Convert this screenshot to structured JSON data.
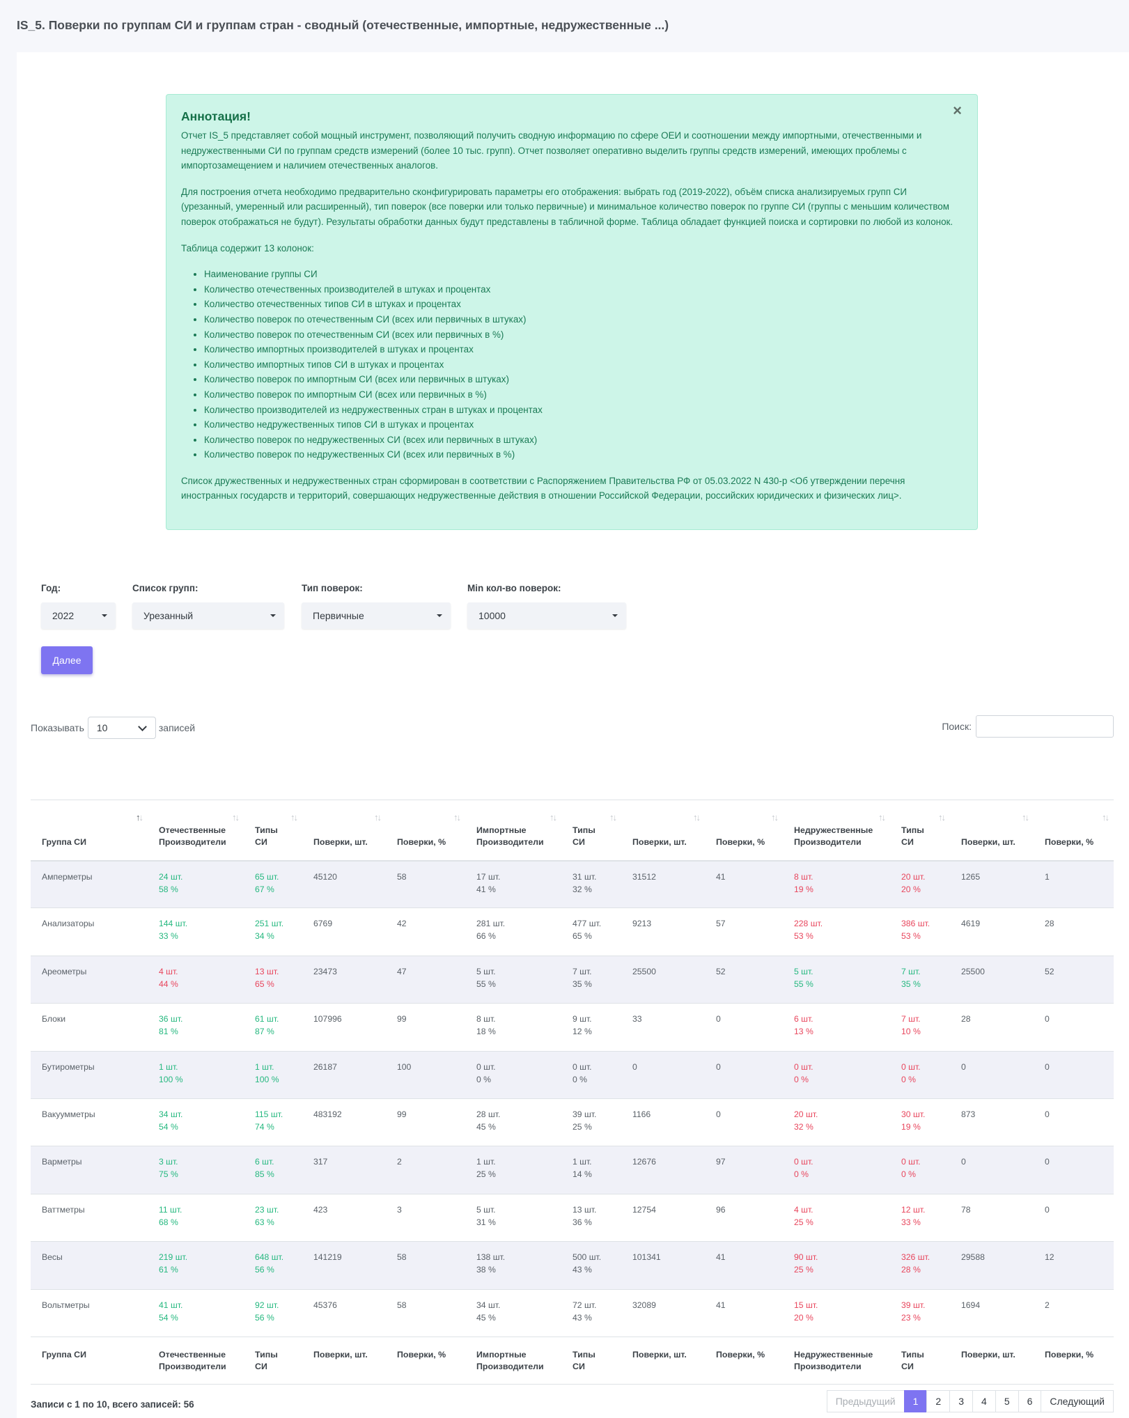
{
  "page_title": "IS_5. Поверки по группам СИ и группам стран - сводный (отечественные, импортные, недружественные ...)",
  "annotation": {
    "title": "Аннотация!",
    "close": "×",
    "p1": "Отчет IS_5 представляет собой мощный инструмент, позволяющий получить сводную информацию по сфере ОЕИ и соотношении между импортными, отечественными и недружественными СИ по группам средств измерений (более 10 тыс. групп). Отчет позволяет оперативно выделить группы средств измерений, имеющих проблемы с импортозамещением и наличием отечественных аналогов.",
    "p2": "Для построения отчета необходимо предварительно сконфигурировать параметры его отображения: выбрать год (2019-2022), объём списка анализируемых групп СИ (урезанный, умеренный или расширенный), тип поверок (все поверки или только первичные) и минимальное количество поверок по группе СИ (группы с меньшим количеством поверок отображаться не будут). Результаты обработки данных будут представлены в табличной форме. Таблица обладает функцией поиска и сортировки по любой из колонок.",
    "p3": "Таблица содержит 13 колонок:",
    "items": [
      "Наименование группы СИ",
      "Количество отечественных производителей в штуках и процентах",
      "Количество отечественных типов СИ в штуках и процентах",
      "Количество поверок по отечественным СИ (всех или первичных в штуках)",
      "Количество поверок по отечественным СИ (всех или первичных в %)",
      "Количество импортных производителей в штуках и процентах",
      "Количество импортных типов СИ в штуках и процентах",
      "Количество поверок по импортным СИ (всех или первичных в штуках)",
      "Количество поверок по импортным СИ (всех или первичных в %)",
      "Количество производителей из недружественных стран в штуках и процентах",
      "Количество недружественных типов СИ в штуках и процентах",
      "Количество поверок по недружественных СИ (всех или первичных в штуках)",
      "Количество поверок по недружественных СИ (всех или первичных в %)"
    ],
    "p4": "Список дружественных и недружественных стран сформирован в соответствии с Распоряжением Правительства РФ от 05.03.2022 N 430-р <Об утверждении перечня иностранных государств и территорий, совершающих недружественные действия в отношении Российской Федерации, российских юридических и физических лиц>."
  },
  "filters": {
    "year": {
      "label": "Год:",
      "value": "2022"
    },
    "groups": {
      "label": "Список групп:",
      "value": "Урезанный"
    },
    "type": {
      "label": "Тип поверок:",
      "value": "Первичные"
    },
    "min": {
      "label": "Min кол-во поверок:",
      "value": "10000"
    },
    "next_button": "Далее"
  },
  "table_controls": {
    "show_label": "Показывать",
    "length": "10",
    "records_label": "записей",
    "search_label": "Поиск:"
  },
  "columns": [
    {
      "l1": "Группа СИ",
      "l2": ""
    },
    {
      "l1": "Отечественные",
      "l2": "Производители"
    },
    {
      "l1": "Типы",
      "l2": "СИ"
    },
    {
      "l1": "Поверки, шт.",
      "l2": ""
    },
    {
      "l1": "Поверки, %",
      "l2": ""
    },
    {
      "l1": "Импортные",
      "l2": "Производители"
    },
    {
      "l1": "Типы",
      "l2": "СИ"
    },
    {
      "l1": "Поверки, шт.",
      "l2": ""
    },
    {
      "l1": "Поверки, %",
      "l2": ""
    },
    {
      "l1": "Недружественные",
      "l2": "Производители"
    },
    {
      "l1": "Типы",
      "l2": "СИ"
    },
    {
      "l1": "Поверки, шт.",
      "l2": ""
    },
    {
      "l1": "Поверки, %",
      "l2": ""
    }
  ],
  "footer_columns": [
    {
      "l1": "Группа СИ",
      "l2": ""
    },
    {
      "l1": "Отечественные",
      "l2": "Производители"
    },
    {
      "l1": "Типы СИ",
      "l2": ""
    },
    {
      "l1": "Поверки, шт.",
      "l2": ""
    },
    {
      "l1": "Поверки, %",
      "l2": ""
    },
    {
      "l1": "Импортные",
      "l2": "Производители"
    },
    {
      "l1": "Типы СИ",
      "l2": ""
    },
    {
      "l1": "Поверки, шт.",
      "l2": ""
    },
    {
      "l1": "Поверки, %",
      "l2": ""
    },
    {
      "l1": "Недружественные",
      "l2": "Производители"
    },
    {
      "l1": "Типы СИ",
      "l2": ""
    },
    {
      "l1": "Поверки, шт.",
      "l2": ""
    },
    {
      "l1": "Поверки, %",
      "l2": ""
    }
  ],
  "rows": [
    {
      "name": "Амперметры",
      "dom": {
        "mfr": [
          "24 шт.",
          "58 %"
        ],
        "types": [
          "65 шт.",
          "67 %"
        ],
        "ver": "45120",
        "pct": "58",
        "color": "g"
      },
      "imp": {
        "mfr": [
          "17 шт.",
          "41 %"
        ],
        "types": [
          "31 шт.",
          "32 %"
        ],
        "ver": "31512",
        "pct": "41"
      },
      "unf": {
        "mfr": [
          "8 шт.",
          "19 %"
        ],
        "types": [
          "20 шт.",
          "20 %"
        ],
        "ver": "1265",
        "pct": "1",
        "color": "r"
      }
    },
    {
      "name": "Анализаторы",
      "dom": {
        "mfr": [
          "144 шт.",
          "33 %"
        ],
        "types": [
          "251 шт.",
          "34 %"
        ],
        "ver": "6769",
        "pct": "42",
        "color": "g"
      },
      "imp": {
        "mfr": [
          "281 шт.",
          "66 %"
        ],
        "types": [
          "477 шт.",
          "65 %"
        ],
        "ver": "9213",
        "pct": "57"
      },
      "unf": {
        "mfr": [
          "228 шт.",
          "53 %"
        ],
        "types": [
          "386 шт.",
          "53 %"
        ],
        "ver": "4619",
        "pct": "28",
        "color": "r"
      }
    },
    {
      "name": "Ареометры",
      "dom": {
        "mfr": [
          "4 шт.",
          "44 %"
        ],
        "types": [
          "13 шт.",
          "65 %"
        ],
        "ver": "23473",
        "pct": "47",
        "color": "r"
      },
      "imp": {
        "mfr": [
          "5 шт.",
          "55 %"
        ],
        "types": [
          "7 шт.",
          "35 %"
        ],
        "ver": "25500",
        "pct": "52"
      },
      "unf": {
        "mfr": [
          "5 шт.",
          "55 %"
        ],
        "types": [
          "7 шт.",
          "35 %"
        ],
        "ver": "25500",
        "pct": "52",
        "color": "g"
      }
    },
    {
      "name": "Блоки",
      "dom": {
        "mfr": [
          "36 шт.",
          "81 %"
        ],
        "types": [
          "61 шт.",
          "87 %"
        ],
        "ver": "107996",
        "pct": "99",
        "color": "g"
      },
      "imp": {
        "mfr": [
          "8 шт.",
          "18 %"
        ],
        "types": [
          "9 шт.",
          "12 %"
        ],
        "ver": "33",
        "pct": "0"
      },
      "unf": {
        "mfr": [
          "6 шт.",
          "13 %"
        ],
        "types": [
          "7 шт.",
          "10 %"
        ],
        "ver": "28",
        "pct": "0",
        "color": "r"
      }
    },
    {
      "name": "Бутирометры",
      "dom": {
        "mfr": [
          "1 шт.",
          "100 %"
        ],
        "types": [
          "1 шт.",
          "100 %"
        ],
        "ver": "26187",
        "pct": "100",
        "color": "g"
      },
      "imp": {
        "mfr": [
          "0 шт.",
          "0 %"
        ],
        "types": [
          "0 шт.",
          "0 %"
        ],
        "ver": "0",
        "pct": "0"
      },
      "unf": {
        "mfr": [
          "0 шт.",
          "0 %"
        ],
        "types": [
          "0 шт.",
          "0 %"
        ],
        "ver": "0",
        "pct": "0",
        "color": "r"
      }
    },
    {
      "name": "Вакуумметры",
      "dom": {
        "mfr": [
          "34 шт.",
          "54 %"
        ],
        "types": [
          "115 шт.",
          "74 %"
        ],
        "ver": "483192",
        "pct": "99",
        "color": "g"
      },
      "imp": {
        "mfr": [
          "28 шт.",
          "45 %"
        ],
        "types": [
          "39 шт.",
          "25 %"
        ],
        "ver": "1166",
        "pct": "0"
      },
      "unf": {
        "mfr": [
          "20 шт.",
          "32 %"
        ],
        "types": [
          "30 шт.",
          "19 %"
        ],
        "ver": "873",
        "pct": "0",
        "color": "r"
      }
    },
    {
      "name": "Варметры",
      "dom": {
        "mfr": [
          "3 шт.",
          "75 %"
        ],
        "types": [
          "6 шт.",
          "85 %"
        ],
        "ver": "317",
        "pct": "2",
        "color": "g"
      },
      "imp": {
        "mfr": [
          "1 шт.",
          "25 %"
        ],
        "types": [
          "1 шт.",
          "14 %"
        ],
        "ver": "12676",
        "pct": "97"
      },
      "unf": {
        "mfr": [
          "0 шт.",
          "0 %"
        ],
        "types": [
          "0 шт.",
          "0 %"
        ],
        "ver": "0",
        "pct": "0",
        "color": "r"
      }
    },
    {
      "name": "Ваттметры",
      "dom": {
        "mfr": [
          "11 шт.",
          "68 %"
        ],
        "types": [
          "23 шт.",
          "63 %"
        ],
        "ver": "423",
        "pct": "3",
        "color": "g"
      },
      "imp": {
        "mfr": [
          "5 шт.",
          "31 %"
        ],
        "types": [
          "13 шт.",
          "36 %"
        ],
        "ver": "12754",
        "pct": "96"
      },
      "unf": {
        "mfr": [
          "4 шт.",
          "25 %"
        ],
        "types": [
          "12 шт.",
          "33 %"
        ],
        "ver": "78",
        "pct": "0",
        "color": "r"
      }
    },
    {
      "name": "Весы",
      "dom": {
        "mfr": [
          "219 шт.",
          "61 %"
        ],
        "types": [
          "648 шт.",
          "56 %"
        ],
        "ver": "141219",
        "pct": "58",
        "color": "g"
      },
      "imp": {
        "mfr": [
          "138 шт.",
          "38 %"
        ],
        "types": [
          "500 шт.",
          "43 %"
        ],
        "ver": "101341",
        "pct": "41"
      },
      "unf": {
        "mfr": [
          "90 шт.",
          "25 %"
        ],
        "types": [
          "326 шт.",
          "28 %"
        ],
        "ver": "29588",
        "pct": "12",
        "color": "r"
      }
    },
    {
      "name": "Вольтметры",
      "dom": {
        "mfr": [
          "41 шт.",
          "54 %"
        ],
        "types": [
          "92 шт.",
          "56 %"
        ],
        "ver": "45376",
        "pct": "58",
        "color": "g"
      },
      "imp": {
        "mfr": [
          "34 шт.",
          "45 %"
        ],
        "types": [
          "72 шт.",
          "43 %"
        ],
        "ver": "32089",
        "pct": "41"
      },
      "unf": {
        "mfr": [
          "15 шт.",
          "20 %"
        ],
        "types": [
          "39 шт.",
          "23 %"
        ],
        "ver": "1694",
        "pct": "2",
        "color": "r"
      }
    }
  ],
  "info": "Записи с 1 по 10, всего записей: 56",
  "pagination": {
    "prev": "Предыдущий",
    "pages": [
      "1",
      "2",
      "3",
      "4",
      "5",
      "6"
    ],
    "active": "1",
    "next": "Следующий"
  },
  "colors": {
    "accent": "#7e74f1",
    "green": "#25b87f",
    "red": "#e8455c",
    "alert_bg": "#cdf5e8"
  }
}
